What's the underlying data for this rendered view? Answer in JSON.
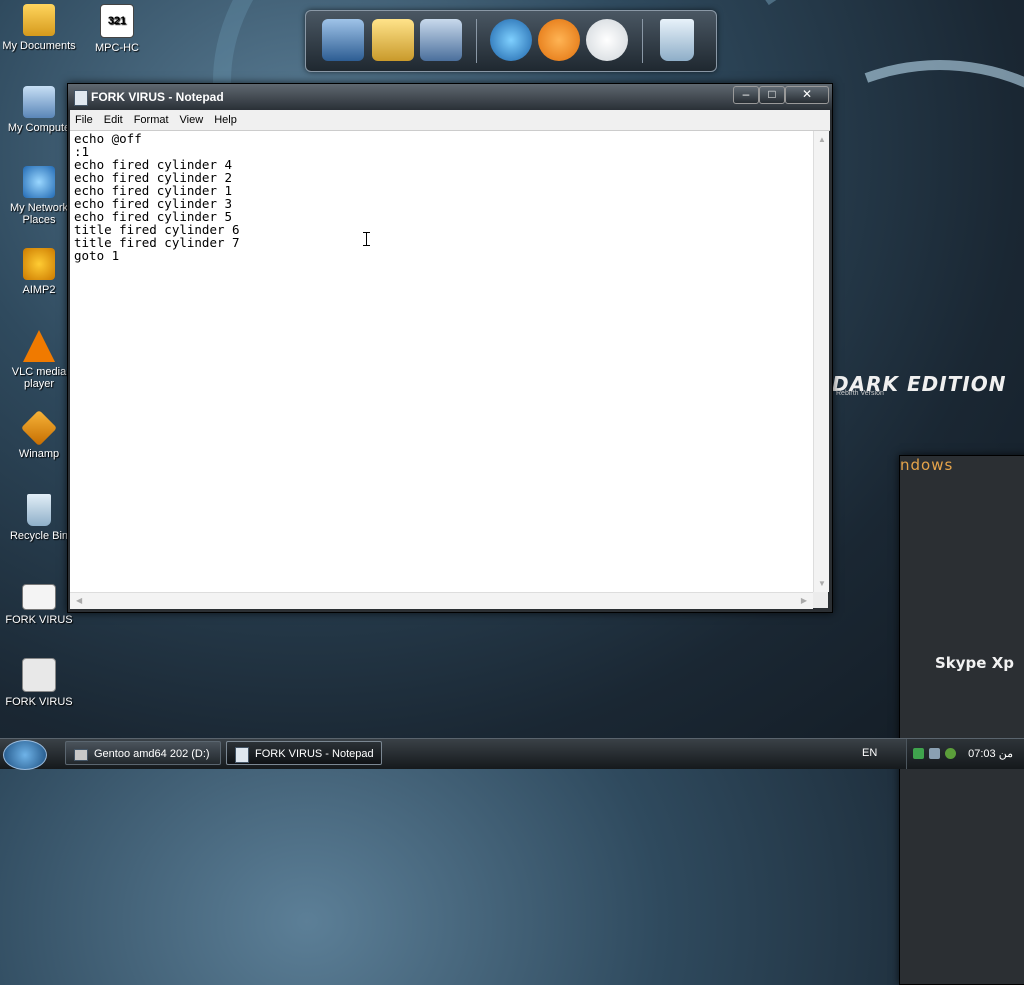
{
  "desktop": {
    "icons": [
      {
        "label": "My Documents",
        "icon": "folder-documents-icon"
      },
      {
        "label": "MPC-HC",
        "icon": "mpc-hc-icon"
      },
      {
        "label": "My Compute",
        "icon": "my-computer-icon"
      },
      {
        "label": "My Network Places",
        "icon": "network-places-icon"
      },
      {
        "label": "AIMP2",
        "icon": "aimp-icon"
      },
      {
        "label": "VLC media player",
        "icon": "vlc-cone-icon"
      },
      {
        "label": "Winamp",
        "icon": "winamp-icon"
      },
      {
        "label": "Recycle Bin",
        "icon": "recycle-bin-icon"
      },
      {
        "label": "FORK VIRUS",
        "icon": "text-file-icon"
      },
      {
        "label": "FORK VIRUS",
        "icon": "batch-file-icon"
      }
    ],
    "mpc_icon_text": "321",
    "wallpaper_brand": "ndows",
    "wallpaper_brand_bold": "DARK EDITION",
    "wallpaper_brand_sub": "Rebirth Version",
    "wallpaper_skype": "Skype Xp"
  },
  "dock": {
    "items": [
      "monitor-icon",
      "folders-icon",
      "control-panel-icon",
      "globe-icon",
      "media-player-icon",
      "clock-icon",
      "recycle-bin-icon"
    ]
  },
  "notepad": {
    "title": "FORK VIRUS - Notepad",
    "controls": {
      "minimize": "–",
      "maximize": "□",
      "close": "✕"
    },
    "menu": [
      "File",
      "Edit",
      "Format",
      "View",
      "Help"
    ],
    "lines": [
      "echo @off",
      ":1",
      "echo fired cylinder 4",
      "echo fired cylinder 2",
      "echo fired cylinder 1",
      "echo fired cylinder 3",
      "echo fired cylinder 5",
      "title fired cylinder 6",
      "title fired cylinder 7",
      "goto 1"
    ]
  },
  "taskbar": {
    "tasks": [
      {
        "label": "Gentoo amd64 202 (D:)",
        "active": false
      },
      {
        "label": "FORK VIRUS - Notepad",
        "active": true
      }
    ],
    "language": "EN",
    "clock": "07:03 من"
  },
  "colors": {
    "accent": "#e6a44a",
    "taskbar": "#1b2024",
    "window_title": "#2a3037"
  }
}
